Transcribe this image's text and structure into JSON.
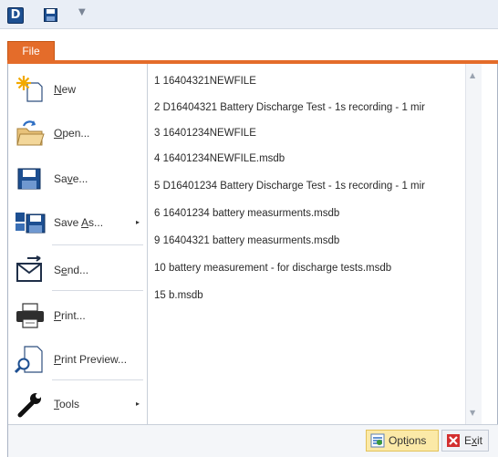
{
  "qat": {
    "app_icon_letter": "D",
    "dropdown_glyph": "▼"
  },
  "file_tab": {
    "label": "File"
  },
  "menu": {
    "items": [
      {
        "id": "new",
        "icon": "new-star-document-icon",
        "mnemonic": "N",
        "rest": "ew",
        "has_submenu": false
      },
      {
        "id": "open",
        "icon": "open-folder-icon",
        "mnemonic": "O",
        "rest": "pen...",
        "has_submenu": false
      },
      {
        "id": "save",
        "icon": "floppy-disk-icon",
        "pre": "Sa",
        "mnemonic": "v",
        "rest": "e...",
        "has_submenu": false
      },
      {
        "id": "save-as",
        "icon": "save-as-icon",
        "pre": "Save ",
        "mnemonic": "A",
        "rest": "s...",
        "has_submenu": true
      },
      {
        "id": "send",
        "icon": "send-envelope-icon",
        "pre": "S",
        "mnemonic": "e",
        "rest": "nd...",
        "has_submenu": false
      },
      {
        "id": "print",
        "icon": "printer-icon",
        "mnemonic": "P",
        "rest": "rint...",
        "has_submenu": false
      },
      {
        "id": "print-preview",
        "icon": "print-preview-icon",
        "mnemonic": "P",
        "rest": "rint Preview...",
        "has_submenu": false
      },
      {
        "id": "tools",
        "icon": "wrench-icon",
        "mnemonic": "T",
        "rest": "ools",
        "has_submenu": true
      }
    ],
    "submenu_arrow": "▸"
  },
  "recent": {
    "items": [
      "1 16404321NEWFILE",
      "2 D16404321 Battery Discharge Test - 1s recording - 1 mir",
      "3 16401234NEWFILE",
      "4 16401234NEWFILE.msdb",
      "5 D16401234 Battery Discharge Test - 1s recording - 1 mir",
      "6 16401234 battery measurments.msdb",
      "9 16404321 battery measurments.msdb",
      "10 battery measurement - for discharge tests.msdb",
      "15 b.msdb"
    ],
    "scroll_up_glyph": "▲",
    "scroll_down_glyph": "▼"
  },
  "footer": {
    "options": {
      "pre": "Opt",
      "mnemonic": "i",
      "rest": "ons",
      "icon": "options-icon"
    },
    "exit": {
      "pre": "E",
      "mnemonic": "x",
      "rest": "it",
      "icon": "exit-x-icon"
    }
  },
  "colors": {
    "file_tab": "#e46c2a",
    "options_bg": "#fbe9a7",
    "exit_icon": "#d32f2f",
    "app_icon": "#1d4f91"
  }
}
